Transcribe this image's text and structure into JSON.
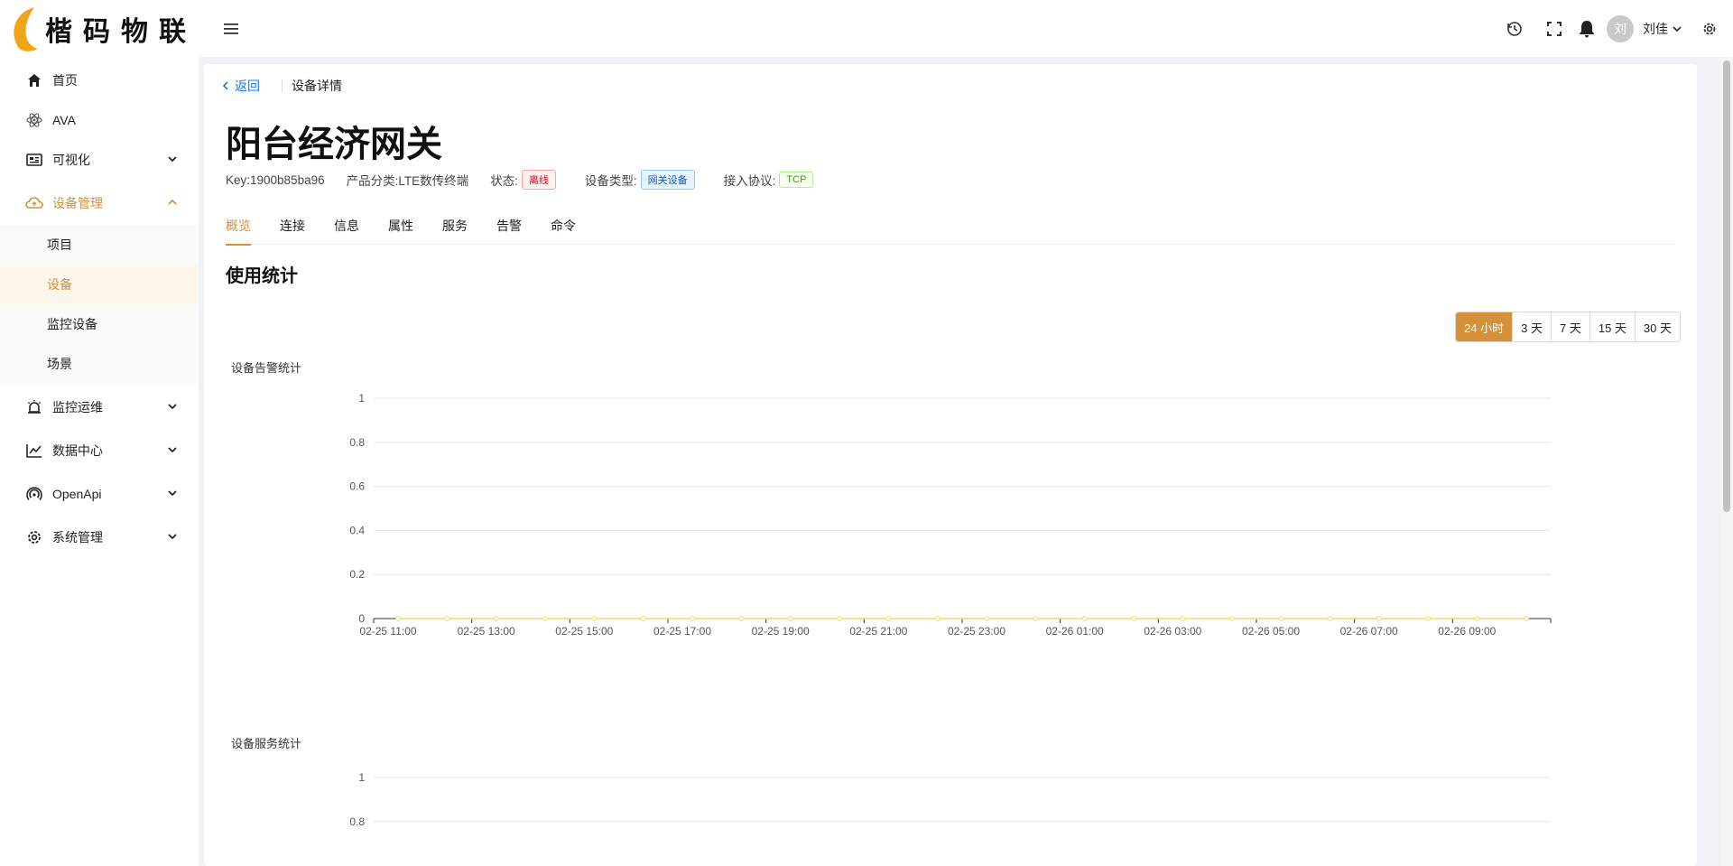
{
  "header": {
    "brand": "楷码物联",
    "user_avatar": "刘",
    "user_name": "刘佳"
  },
  "sidebar": {
    "items": [
      {
        "label": "首页",
        "icon": "home-icon"
      },
      {
        "label": "AVA",
        "icon": "atom-icon"
      },
      {
        "label": "可视化",
        "icon": "dashboard-icon"
      },
      {
        "label": "设备管理",
        "icon": "cloud-icon"
      },
      {
        "label": "监控运维",
        "icon": "alarm-icon"
      },
      {
        "label": "数据中心",
        "icon": "chart-line-icon"
      },
      {
        "label": "OpenApi",
        "icon": "signal-icon"
      },
      {
        "label": "系统管理",
        "icon": "gear-icon"
      }
    ],
    "device_submenu": [
      "项目",
      "设备",
      "监控设备",
      "场景"
    ]
  },
  "breadcrumb": {
    "back": "返回",
    "current": "设备详情"
  },
  "device": {
    "name": "阳台经济网关",
    "key": "Key:1900b85ba96",
    "category": "产品分类:LTE数传终端",
    "status_label": "状态:",
    "status": "离线",
    "type_label": "设备类型:",
    "type": "网关设备",
    "protocol_label": "接入协议:",
    "protocol": "TCP"
  },
  "tabs": [
    "概览",
    "连接",
    "信息",
    "属性",
    "服务",
    "告警",
    "命令"
  ],
  "section_title": "使用统计",
  "ranges": [
    "24 小时",
    "3 天",
    "7 天",
    "15 天",
    "30 天"
  ],
  "colors": {
    "accent": "#d4913a",
    "line": "#f5d76e"
  },
  "chart_data": [
    {
      "type": "line",
      "title": "设备告警统计",
      "x": [
        "02-25 11:00",
        "02-25 13:00",
        "02-25 15:00",
        "02-25 17:00",
        "02-25 19:00",
        "02-25 21:00",
        "02-25 23:00",
        "02-26 01:00",
        "02-26 03:00",
        "02-26 05:00",
        "02-26 07:00",
        "02-26 09:00"
      ],
      "y_ticks": [
        0,
        0.2,
        0.4,
        0.6,
        0.8,
        1
      ],
      "ylim": [
        0,
        1
      ],
      "series": [
        {
          "values": [
            0,
            0,
            0,
            0,
            0,
            0,
            0,
            0,
            0,
            0,
            0,
            0,
            0,
            0,
            0,
            0,
            0,
            0,
            0,
            0,
            0,
            0,
            0,
            0
          ]
        }
      ],
      "grid": true
    },
    {
      "type": "line",
      "title": "设备服务统计",
      "y_ticks": [
        0.8,
        1
      ],
      "ylim": [
        0,
        1
      ],
      "grid": true
    }
  ]
}
